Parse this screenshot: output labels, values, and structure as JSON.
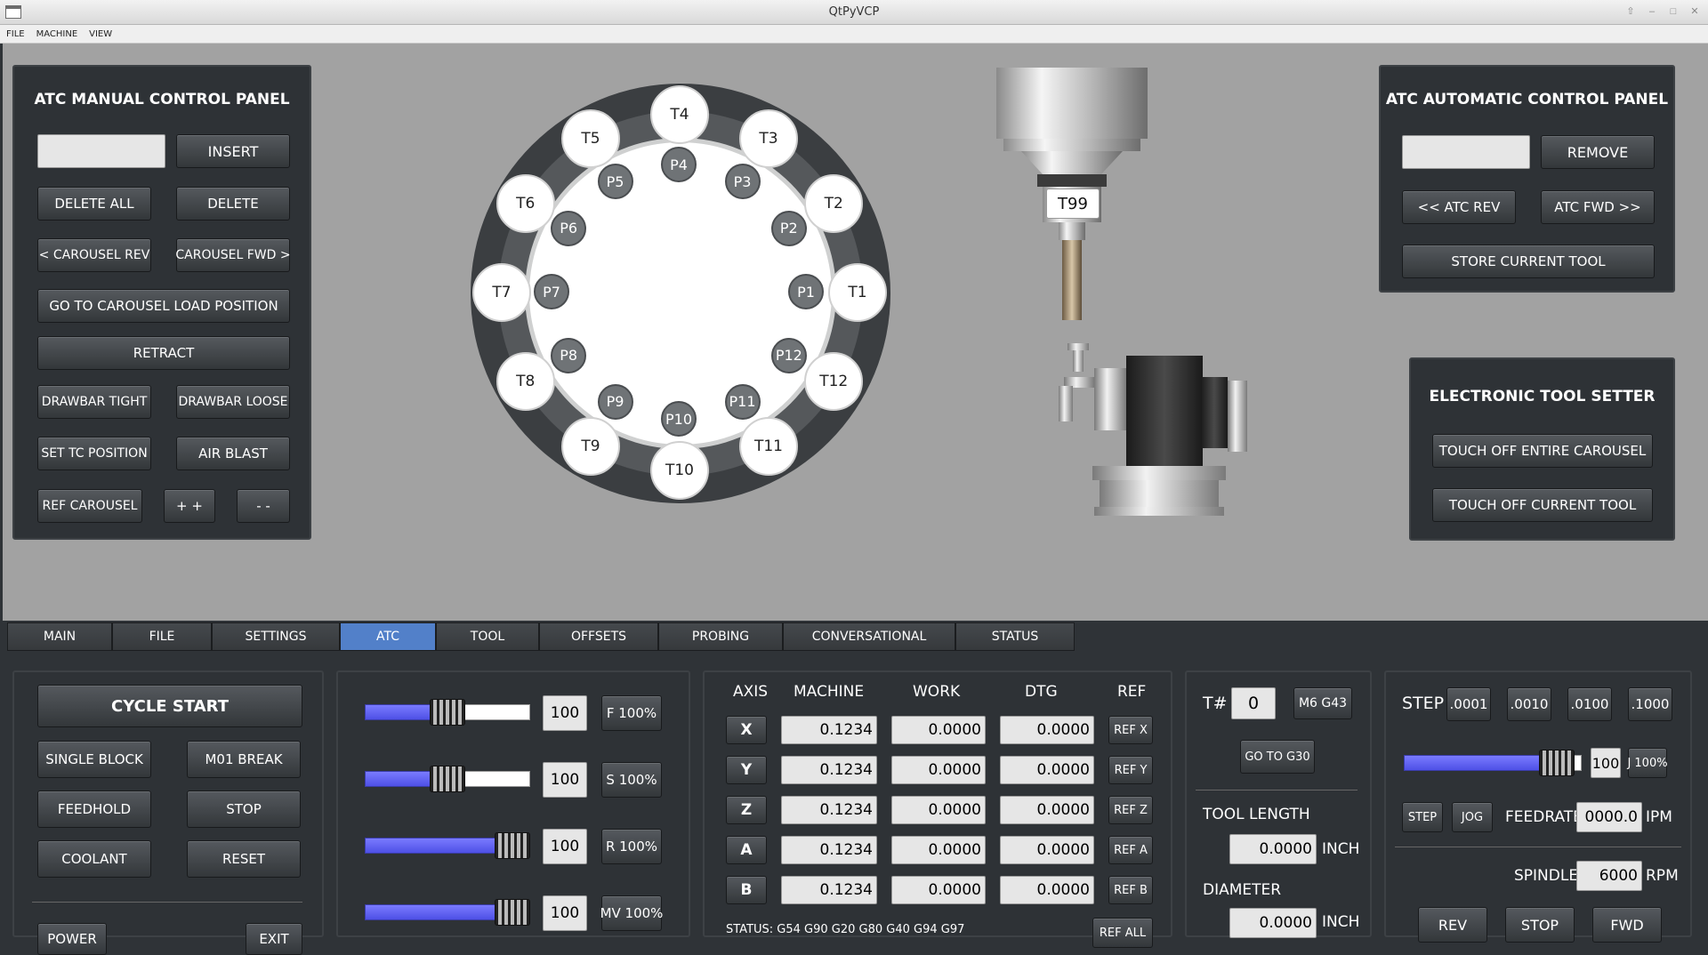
{
  "window": {
    "title": "QtPyVCP"
  },
  "menu": [
    "FILE",
    "MACHINE",
    "VIEW"
  ],
  "atc_manual": {
    "title": "ATC MANUAL CONTROL PANEL",
    "input_value": "",
    "insert": "INSERT",
    "delete_all": "DELETE ALL",
    "delete": "DELETE",
    "carousel_rev": "< CAROUSEL REV",
    "carousel_fwd": "CAROUSEL FWD >",
    "goto_load": "GO TO CAROUSEL LOAD POSITION",
    "retract": "RETRACT",
    "drawbar_tight": "DRAWBAR TIGHT",
    "drawbar_loose": "DRAWBAR LOOSE",
    "set_tc": "SET TC POSITION",
    "air_blast": "AIR BLAST",
    "ref_carousel": "REF CAROUSEL",
    "plus": "+ +",
    "minus": "- -"
  },
  "carousel": {
    "tools": [
      "T1",
      "T2",
      "T3",
      "T4",
      "T5",
      "T6",
      "T7",
      "T8",
      "T9",
      "T10",
      "T11",
      "T12"
    ],
    "pockets": [
      "P1",
      "P2",
      "P3",
      "P4",
      "P5",
      "P6",
      "P7",
      "P8",
      "P9",
      "P10",
      "P11",
      "P12"
    ]
  },
  "spindle_tool": "T99",
  "atc_auto": {
    "title": "ATC AUTOMATIC CONTROL PANEL",
    "input_value": "",
    "remove": "REMOVE",
    "atc_rev": "<< ATC REV",
    "atc_fwd": "ATC FWD >>",
    "store": "STORE CURRENT TOOL"
  },
  "tool_setter": {
    "title": "ELECTRONIC TOOL SETTER",
    "touch_carousel": "TOUCH OFF ENTIRE CAROUSEL",
    "touch_current": "TOUCH OFF CURRENT TOOL"
  },
  "tabs": [
    {
      "label": "MAIN",
      "active": false
    },
    {
      "label": "FILE",
      "active": false
    },
    {
      "label": "SETTINGS",
      "active": false
    },
    {
      "label": "ATC",
      "active": true
    },
    {
      "label": "TOOL",
      "active": false
    },
    {
      "label": "OFFSETS",
      "active": false
    },
    {
      "label": "PROBING",
      "active": false
    },
    {
      "label": "CONVERSATIONAL",
      "active": false
    },
    {
      "label": "STATUS",
      "active": false
    }
  ],
  "program": {
    "cycle_start": "CYCLE START",
    "single_block": "SINGLE BLOCK",
    "m01_break": "M01 BREAK",
    "feedhold": "FEEDHOLD",
    "stop": "STOP",
    "coolant": "COOLANT",
    "reset": "RESET",
    "power": "POWER",
    "exit": "EXIT"
  },
  "overrides": [
    {
      "value": "100",
      "button": "F 100%",
      "level": 0.5
    },
    {
      "value": "100",
      "button": "S 100%",
      "level": 0.5
    },
    {
      "value": "100",
      "button": "R 100%",
      "level": 1.0
    },
    {
      "value": "100",
      "button": "MV 100%",
      "level": 1.0
    }
  ],
  "dro": {
    "headers": {
      "axis": "AXIS",
      "machine": "MACHINE",
      "work": "WORK",
      "dtg": "DTG",
      "ref": "REF"
    },
    "rows": [
      {
        "axis": "X",
        "machine": "0.1234",
        "work": "0.0000",
        "dtg": "0.0000",
        "ref": "REF X"
      },
      {
        "axis": "Y",
        "machine": "0.1234",
        "work": "0.0000",
        "dtg": "0.0000",
        "ref": "REF Y"
      },
      {
        "axis": "Z",
        "machine": "0.1234",
        "work": "0.0000",
        "dtg": "0.0000",
        "ref": "REF Z"
      },
      {
        "axis": "A",
        "machine": "0.1234",
        "work": "0.0000",
        "dtg": "0.0000",
        "ref": "REF A"
      },
      {
        "axis": "B",
        "machine": "0.1234",
        "work": "0.0000",
        "dtg": "0.0000",
        "ref": "REF B"
      }
    ],
    "status": "STATUS: G54 G90 G20 G80 G40 G94 G97",
    "ref_all": "REF ALL"
  },
  "tool_info": {
    "tnum_label": "T#",
    "tnum_value": "0",
    "m6g43": "M6 G43",
    "goto_g30": "GO TO G30",
    "tool_length_label": "TOOL LENGTH",
    "tool_length": "0.0000",
    "tool_length_unit": "INCH",
    "diameter_label": "DIAMETER",
    "diameter": "0.0000",
    "diameter_unit": "INCH"
  },
  "jog": {
    "step_label": "STEP",
    "steps": [
      ".0001",
      ".0010",
      ".0100",
      ".1000"
    ],
    "jog_value": "100",
    "jog_pct": "J 100%",
    "jog_level": 0.88,
    "step_btn": "STEP",
    "jog_btn": "JOG",
    "feedrate_label": "FEEDRATE",
    "feedrate": "0000.0",
    "feedrate_unit": "IPM",
    "spindle_label": "SPINDLE",
    "spindle": "6000",
    "spindle_unit": "RPM",
    "rev": "REV",
    "stop": "STOP",
    "fwd": "FWD"
  }
}
